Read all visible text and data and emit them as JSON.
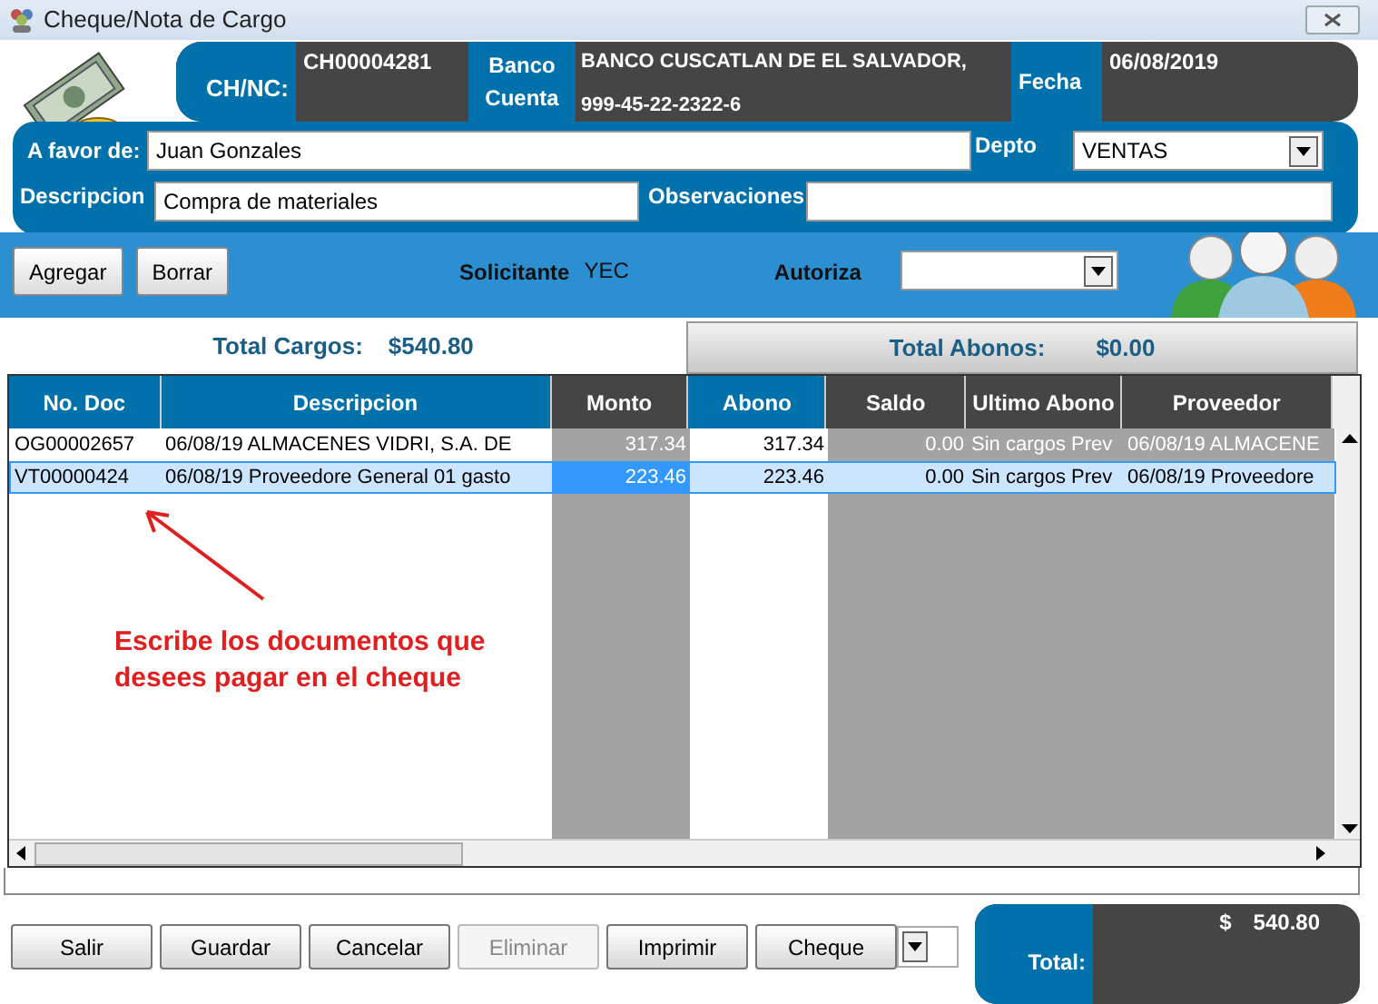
{
  "window": {
    "title": "Cheque/Nota de Cargo"
  },
  "header": {
    "chnc_label": "CH/NC:",
    "chnc": "CH00004281",
    "banco_label": "Banco",
    "cuenta_label": "Cuenta",
    "banco": "BANCO CUSCATLAN DE EL SALVADOR,",
    "cuenta": "999-45-22-2322-6",
    "fecha_label": "Fecha",
    "fecha": "06/08/2019"
  },
  "form": {
    "afavor_label": "A favor de:",
    "afavor": "Juan Gonzales",
    "depto_label": "Depto",
    "depto": "VENTAS",
    "descripcion_label": "Descripcion",
    "descripcion": "Compra de materiales",
    "observaciones_label": "Observaciones"
  },
  "toolbar": {
    "buttons": [
      "Agregar",
      "Borrar"
    ],
    "solicitante_label": "Solicitante",
    "solicitante": "YEC",
    "autoriza_label": "Autoriza"
  },
  "totals": {
    "cargos_label": "Total Cargos:",
    "cargos": "$540.80",
    "abonos_label": "Total Abonos:",
    "abonos": "$0.00"
  },
  "table": {
    "columns": [
      {
        "label": "No. Doc",
        "kind": "input"
      },
      {
        "label": "Descripcion",
        "kind": "input"
      },
      {
        "label": "Monto",
        "kind": "readonly"
      },
      {
        "label": "Abono",
        "kind": "input"
      },
      {
        "label": "Saldo",
        "kind": "readonly"
      },
      {
        "label": "Ultimo Abono",
        "kind": "readonly"
      },
      {
        "label": "Proveedor",
        "kind": "readonly"
      }
    ],
    "rows": [
      {
        "selected": false,
        "cells": [
          "OG00002657",
          "06/08/19 ALMACENES VIDRI, S.A. DE",
          "317.34",
          "317.34",
          "0.00",
          "Sin cargos Prev",
          "06/08/19 ALMACENE"
        ]
      },
      {
        "selected": true,
        "cells": [
          "VT00000424",
          "06/08/19 Proveedore General 01 gasto",
          "223.46",
          "223.46",
          "0.00",
          "Sin cargos Prev",
          "06/08/19 Proveedore"
        ]
      }
    ]
  },
  "annotation": "Escribe los documentos que desees pagar en el cheque",
  "footer": {
    "buttons": [
      {
        "label": "Salir",
        "disabled": false
      },
      {
        "label": "Guardar",
        "disabled": false
      },
      {
        "label": "Cancelar",
        "disabled": false
      },
      {
        "label": "Eliminar",
        "disabled": true
      },
      {
        "label": "Imprimir",
        "disabled": false
      },
      {
        "label": "Cheque",
        "disabled": false
      }
    ],
    "total_label": "Total:",
    "total_currency": "$",
    "total": "540.80"
  }
}
